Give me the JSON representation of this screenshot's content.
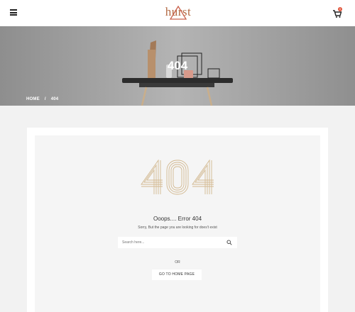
{
  "header": {
    "logo_text": "hurst",
    "cart_count": "0"
  },
  "hero": {
    "title": "404",
    "breadcrumb": {
      "home": "HOME",
      "separator": "/",
      "current": "404"
    }
  },
  "error": {
    "big_code": "404",
    "title": "Ooops.... Error 404",
    "subtitle": "Sorry, But the page you are looking for does't exist",
    "search_placeholder": "Search here...",
    "or_text": "OR",
    "home_button": "GO TO HOME PAGE"
  },
  "colors": {
    "accent": "#b36b45",
    "badge": "#e2583f",
    "gold": "#d2b88f"
  }
}
